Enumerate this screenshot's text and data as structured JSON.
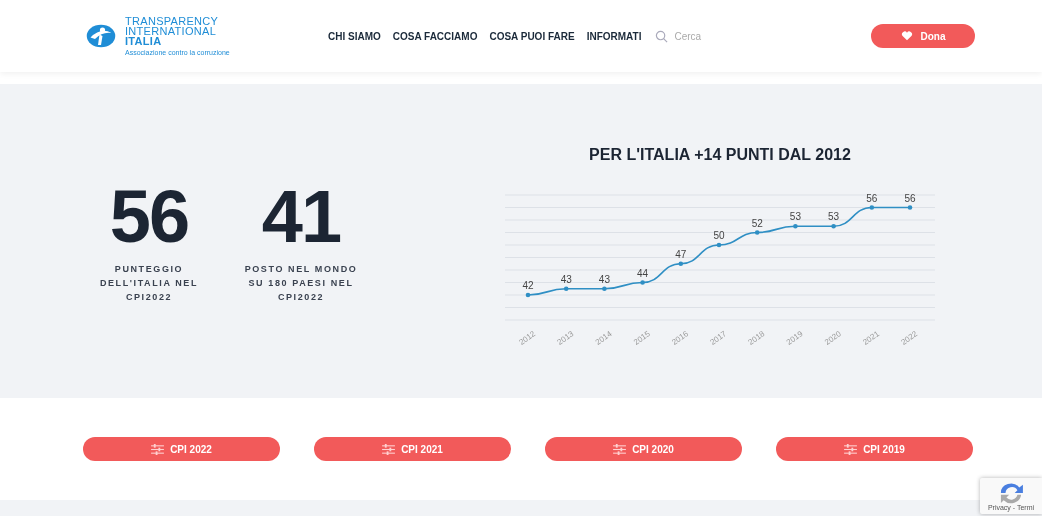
{
  "header": {
    "logo": {
      "lines": [
        "TRANSPARENCY",
        "INTERNATIONAL",
        "ITALIA"
      ],
      "tagline": "Associazione contro la corruzione"
    },
    "nav": [
      "CHI SIAMO",
      "COSA FACCIAMO",
      "COSA PUOI FARE",
      "INFORMATI"
    ],
    "search": {
      "placeholder": "Cerca"
    },
    "donate_button": "Dona"
  },
  "stats": [
    {
      "value": "56",
      "label": "PUNTEGGIO DELL'ITALIA NEL CPI2022"
    },
    {
      "value": "41",
      "label": "POSTO NEL MONDO SU 180 PAESI NEL CPI2022"
    }
  ],
  "chart": {
    "chart_data": {
      "type": "line",
      "title": "PER L'ITALIA +14 PUNTI DAL 2012",
      "categories": [
        "2012",
        "2013",
        "2014",
        "2015",
        "2016",
        "2017",
        "2018",
        "2019",
        "2020",
        "2021",
        "2022"
      ],
      "series": [
        {
          "color": "#2f8fc4",
          "values": [
            42,
            43,
            43,
            44,
            47,
            50,
            52,
            53,
            53,
            56,
            56
          ]
        }
      ],
      "ylim": [
        38,
        58
      ],
      "data_labels": true
    }
  },
  "report_buttons": [
    "CPI 2022",
    "CPI 2021",
    "CPI 2020",
    "CPI 2019"
  ],
  "recaptcha": {
    "text": "Privacy - Termi"
  }
}
